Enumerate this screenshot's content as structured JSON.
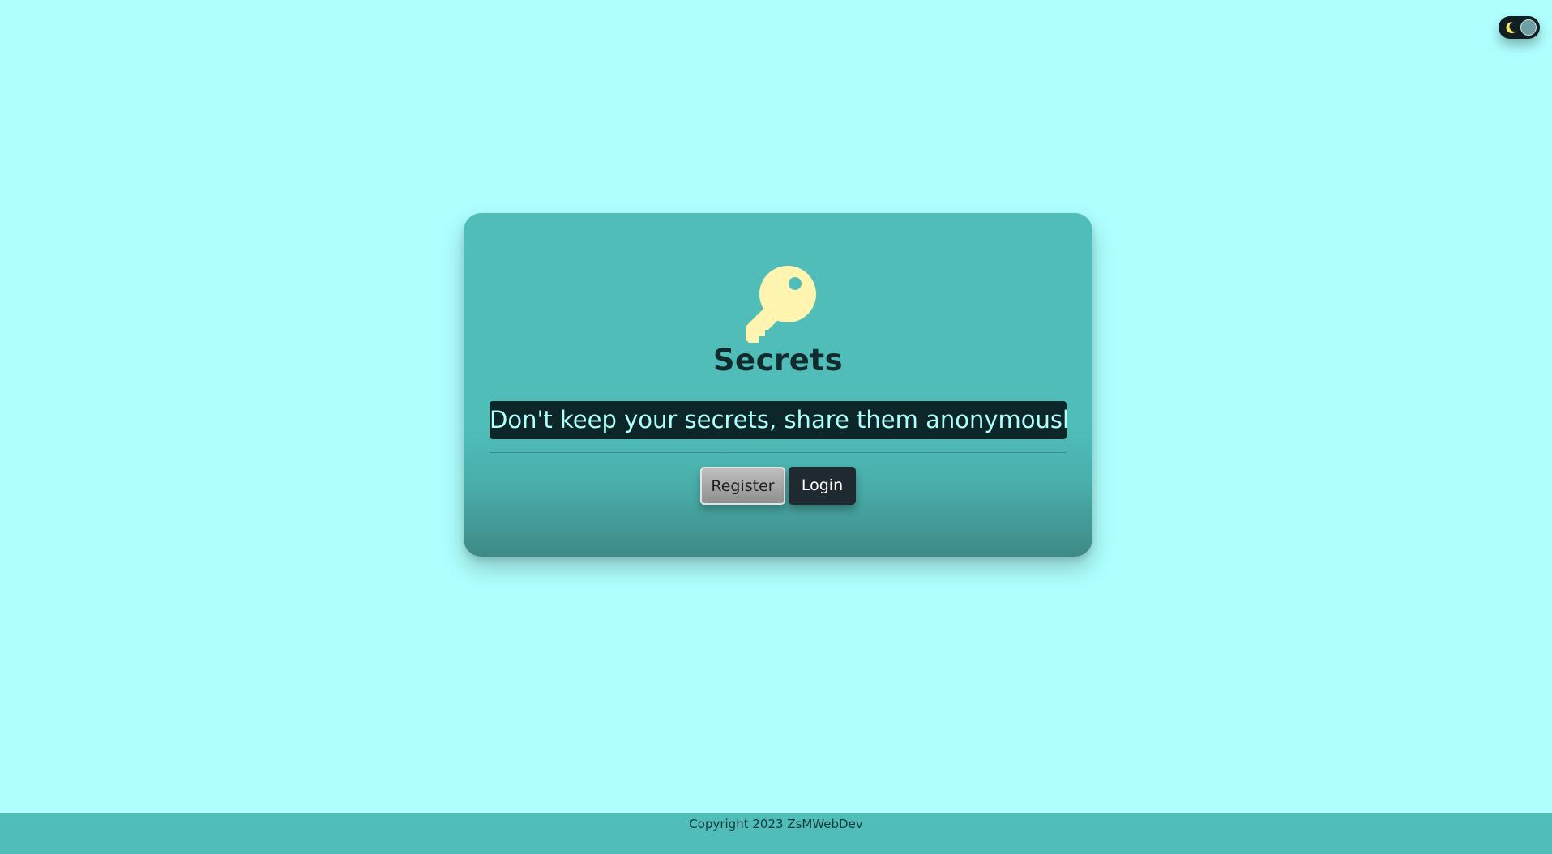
{
  "theme_toggle": {
    "icon": "moon-icon",
    "state": "dark-mode-off"
  },
  "card": {
    "icon": "key-icon",
    "title": "Secrets",
    "tagline": "Don't keep your secrets, share them anonymously!",
    "buttons": {
      "register_label": "Register",
      "login_label": "Login"
    }
  },
  "footer": {
    "copyright": "Copyright 2023 ZsMWebDev"
  },
  "colors": {
    "background": "#aefffe",
    "card": "#50bdb9",
    "key_icon": "#fff4b0",
    "tagline_bg": "#0d2627",
    "tagline_text": "#aefffe",
    "login_button": "#1f2a30"
  }
}
